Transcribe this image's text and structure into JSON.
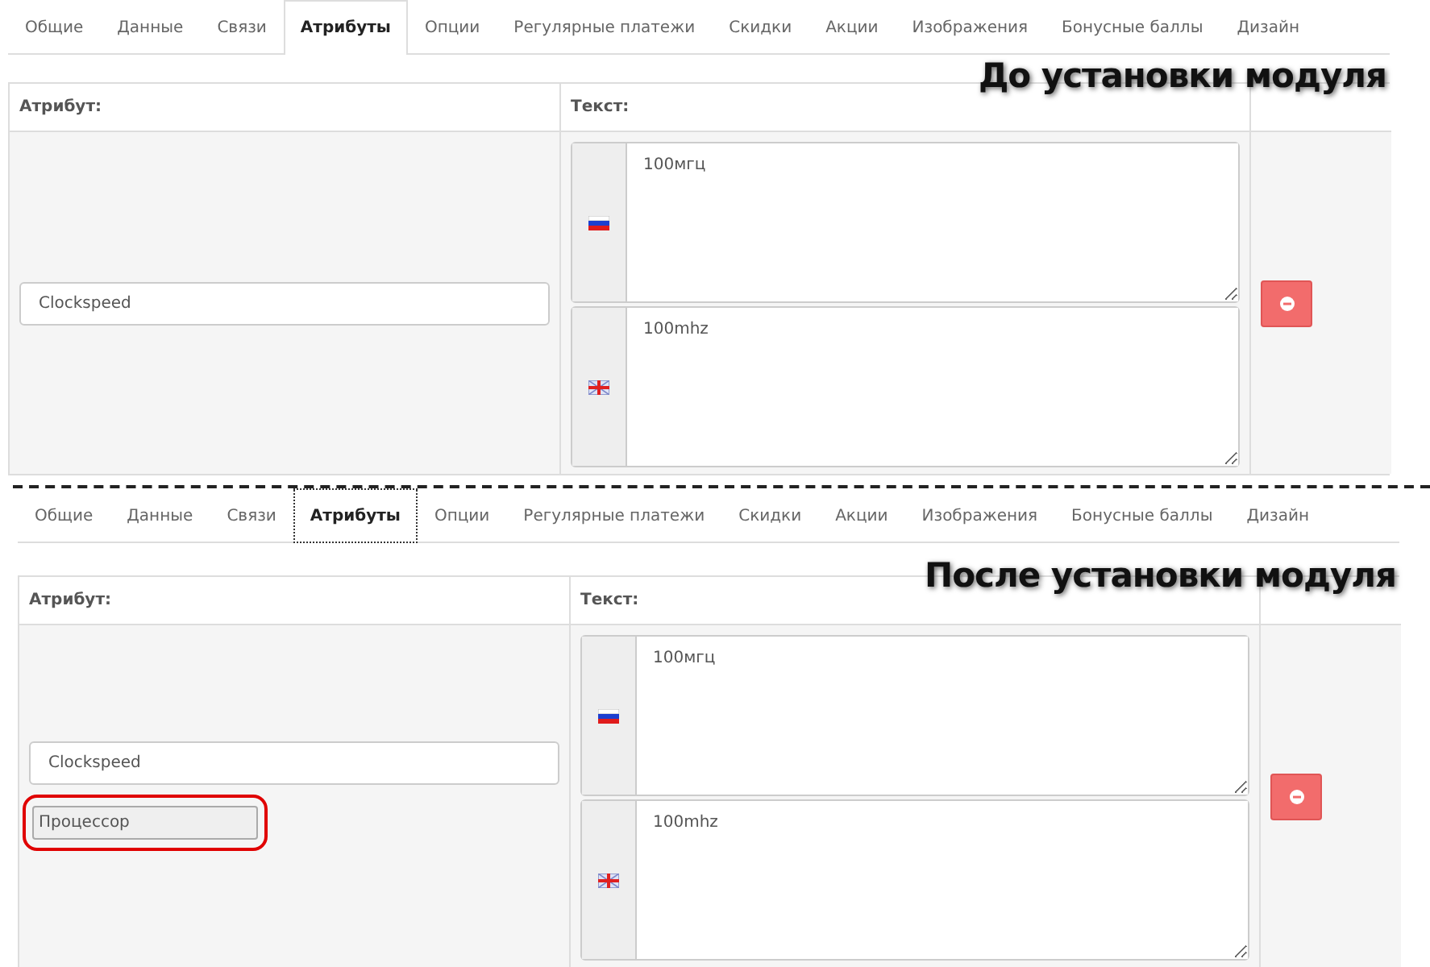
{
  "panels": [
    {
      "caption": "До установки модуля",
      "tabs": [
        {
          "label": "Общие",
          "selected": false,
          "focused": false
        },
        {
          "label": "Данные",
          "selected": false,
          "focused": false
        },
        {
          "label": "Связи",
          "selected": false,
          "focused": false
        },
        {
          "label": "Атрибуты",
          "selected": true,
          "focused": false
        },
        {
          "label": "Опции",
          "selected": false,
          "focused": false
        },
        {
          "label": "Регулярные платежи",
          "selected": false,
          "focused": false
        },
        {
          "label": "Скидки",
          "selected": false,
          "focused": false
        },
        {
          "label": "Акции",
          "selected": false,
          "focused": false
        },
        {
          "label": "Изображения",
          "selected": false,
          "focused": false
        },
        {
          "label": "Бонусные баллы",
          "selected": false,
          "focused": false
        },
        {
          "label": "Дизайн",
          "selected": false,
          "focused": false
        }
      ],
      "columns": [
        "Атрибут:",
        "Текст:"
      ],
      "row": {
        "attribute": "Clockspeed",
        "texts": [
          {
            "kind": "ru",
            "value": "100мгц"
          },
          {
            "kind": "en",
            "value": "100mhz"
          }
        ]
      }
    },
    {
      "caption": "После установки модуля",
      "tabs": [
        {
          "label": "Общие",
          "selected": false,
          "focused": false
        },
        {
          "label": "Данные",
          "selected": false,
          "focused": false
        },
        {
          "label": "Связи",
          "selected": false,
          "focused": false
        },
        {
          "label": "Атрибуты",
          "selected": true,
          "focused": true
        },
        {
          "label": "Опции",
          "selected": false,
          "focused": false
        },
        {
          "label": "Регулярные платежи",
          "selected": false,
          "focused": false
        },
        {
          "label": "Скидки",
          "selected": false,
          "focused": false
        },
        {
          "label": "Акции",
          "selected": false,
          "focused": false
        },
        {
          "label": "Изображения",
          "selected": false,
          "focused": false
        },
        {
          "label": "Бонусные баллы",
          "selected": false,
          "focused": false
        },
        {
          "label": "Дизайн",
          "selected": false,
          "focused": false
        }
      ],
      "columns": [
        "Атрибут:",
        "Текст:"
      ],
      "row": {
        "attribute": "Clockspeed",
        "group": {
          "value": "Процессор",
          "highlighted": true
        },
        "texts": [
          {
            "kind": "ru",
            "value": "100мгц"
          },
          {
            "kind": "en",
            "value": "100mhz"
          }
        ]
      }
    }
  ]
}
